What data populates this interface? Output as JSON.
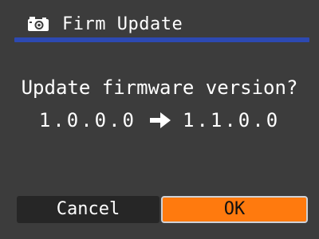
{
  "header": {
    "title": "Firm Update",
    "icon": "camera-icon"
  },
  "dialog": {
    "question": "Update firmware version?",
    "current_version": "1.0.0.0",
    "new_version": "1.1.0.0",
    "arrow_icon": "right-arrow-icon"
  },
  "buttons": {
    "cancel_label": "Cancel",
    "ok_label": "OK"
  },
  "colors": {
    "background": "#3c3c3c",
    "header_rule": "#2d49b2",
    "cancel_bg": "#262626",
    "ok_bg": "#ff7a0e",
    "ok_border": "#cfd2d8"
  }
}
